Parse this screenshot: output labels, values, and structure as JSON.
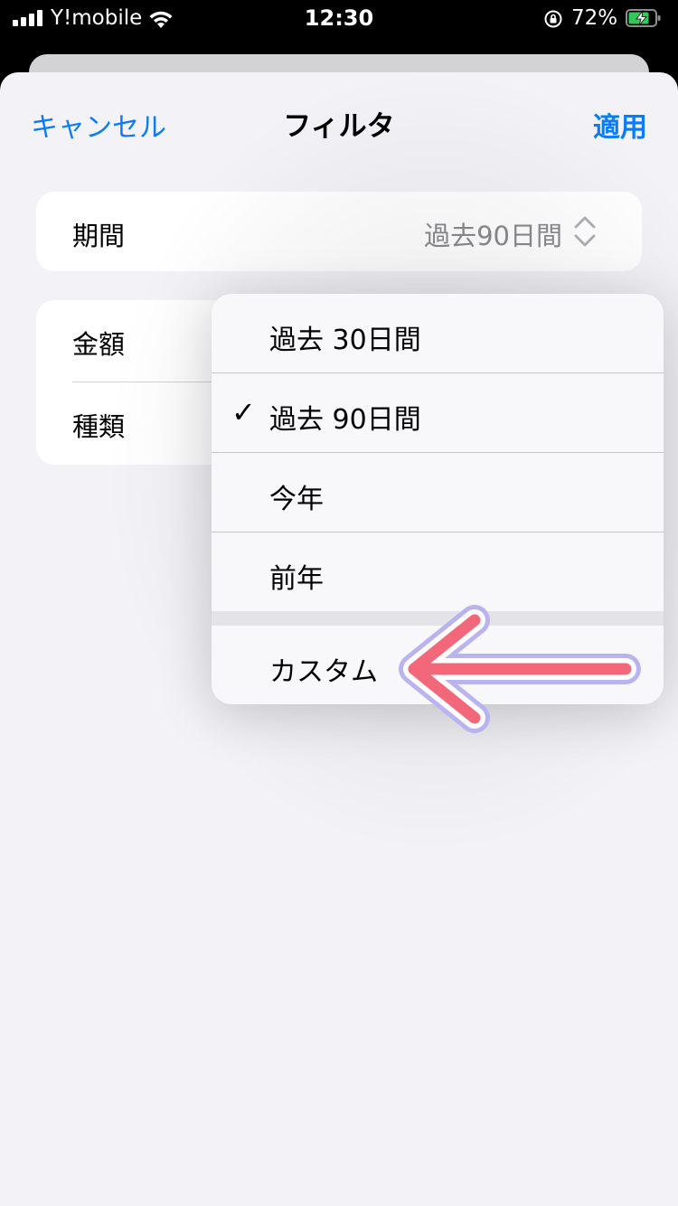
{
  "status_bar": {
    "carrier": "Y!mobile",
    "time": "12:30",
    "battery_percent": "72%",
    "battery_level": 0.72,
    "icons": [
      "signal-icon",
      "wifi-icon",
      "orientation-lock-icon",
      "battery-charging-icon"
    ]
  },
  "nav": {
    "cancel": "キャンセル",
    "title": "フィルタ",
    "apply": "適用"
  },
  "form": {
    "period_label": "期間",
    "period_value": "過去90日間",
    "amount_label": "金額",
    "type_label": "種類"
  },
  "menu": {
    "items": [
      {
        "label": "過去 30日間",
        "checked": false
      },
      {
        "label": "過去 90日間",
        "checked": true
      },
      {
        "label": "今年",
        "checked": false
      },
      {
        "label": "前年",
        "checked": false
      },
      {
        "label": "カスタム",
        "checked": false
      }
    ],
    "check_glyph": "✓"
  },
  "annotation": {
    "arrow_color": "#f2687a",
    "outline_color": "#b9b4f0"
  },
  "colors": {
    "accent": "#0a7cf5",
    "background": "#f2f2f7",
    "secondary_text": "#8a8a8e"
  }
}
